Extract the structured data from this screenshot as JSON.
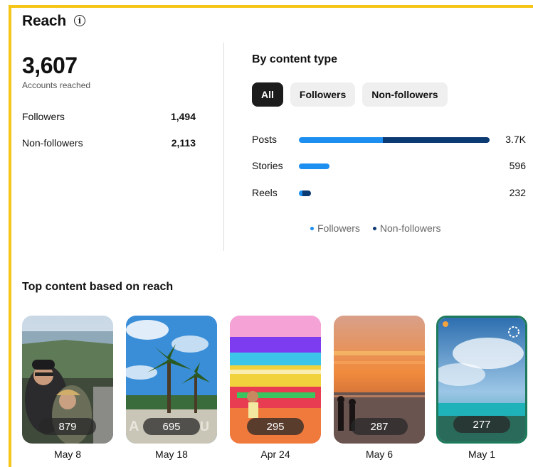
{
  "header": {
    "title": "Reach",
    "info_icon": "info-icon"
  },
  "summary": {
    "total": "3,607",
    "total_label": "Accounts reached",
    "rows": [
      {
        "label": "Followers",
        "value": "1,494"
      },
      {
        "label": "Non-followers",
        "value": "2,113"
      }
    ]
  },
  "by_content": {
    "heading": "By content type",
    "tabs": [
      {
        "label": "All",
        "active": true
      },
      {
        "label": "Followers",
        "active": false
      },
      {
        "label": "Non-followers",
        "active": false
      }
    ],
    "colors": {
      "followers": "#1d8ff0",
      "non_followers": "#0c3a73"
    },
    "bars": [
      {
        "label": "Posts",
        "value": "3.7K",
        "followers_fraction": 0.44,
        "total_fraction": 1.0
      },
      {
        "label": "Stories",
        "value": "596",
        "followers_fraction": 1.0,
        "total_fraction": 0.161
      },
      {
        "label": "Reels",
        "value": "232",
        "followers_fraction": 0.3,
        "total_fraction": 0.063
      }
    ],
    "legend": [
      {
        "label": "Followers",
        "color": "#1d8ff0"
      },
      {
        "label": "Non-followers",
        "color": "#0c3a73"
      }
    ]
  },
  "top_content": {
    "heading": "Top content based on reach",
    "items": [
      {
        "count": "879",
        "date": "May 8"
      },
      {
        "count": "695",
        "date": "May 18"
      },
      {
        "count": "295",
        "date": "Apr 24"
      },
      {
        "count": "287",
        "date": "May 6"
      },
      {
        "count": "277",
        "date": "May 1"
      }
    ]
  }
}
